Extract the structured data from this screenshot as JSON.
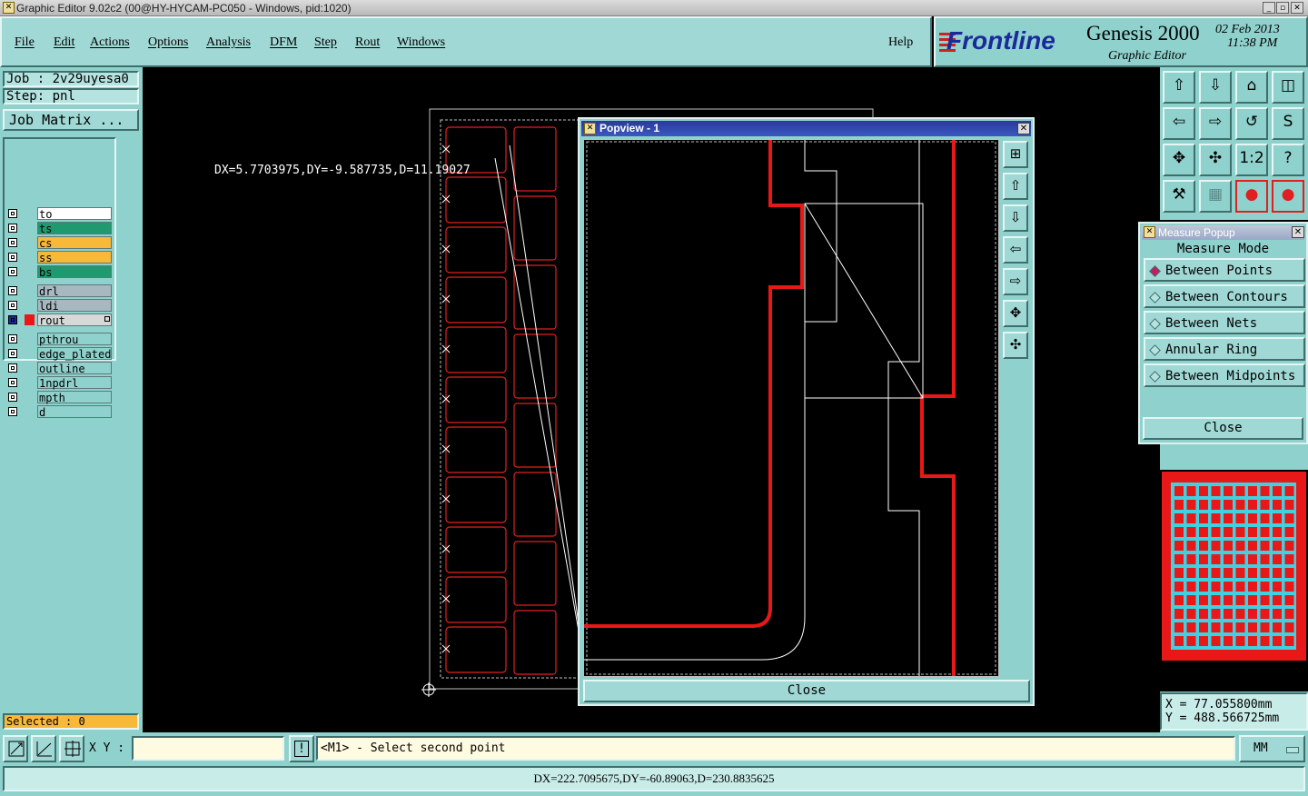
{
  "window": {
    "title": "Graphic Editor 9.02c2 (00@HY-HYCAM-PC050 - Windows, pid:1020)",
    "buttons": [
      "_",
      "▫",
      "✕"
    ]
  },
  "menu": [
    "File",
    "Edit",
    "Actions",
    "Options",
    "Analysis",
    "DFM",
    "Step",
    "Rout",
    "Windows"
  ],
  "help_label": "Help",
  "brand": {
    "logo": "Frontline",
    "product": "Genesis 2000",
    "subtitle": "Graphic Editor",
    "date": "02 Feb 2013",
    "time": "11:38 PM"
  },
  "job": {
    "job_label": "Job : 2v29uyesa0",
    "step_label": "Step: pnl",
    "matrix_button": "Job Matrix ..."
  },
  "layers": [
    {
      "name": "to",
      "color": "#ffffff"
    },
    {
      "name": "ts",
      "color": "#1f9a6e"
    },
    {
      "name": "cs",
      "color": "#f8b838"
    },
    {
      "name": "ss",
      "color": "#f8b838"
    },
    {
      "name": "bs",
      "color": "#1f9a6e"
    },
    {
      "name": "drl",
      "color": "#a8b8c0"
    },
    {
      "name": "ldi",
      "color": "#a8b8c0"
    },
    {
      "name": "rout",
      "color": "#d8d8d8",
      "active": true
    },
    {
      "name": "pthrou",
      "color": "#8fd1cd"
    },
    {
      "name": "edge_plated",
      "color": "#8fd1cd"
    },
    {
      "name": "outline",
      "color": "#8fd1cd"
    },
    {
      "name": "1npdrl",
      "color": "#8fd1cd"
    },
    {
      "name": "mpth",
      "color": "#8fd1cd"
    },
    {
      "name": "d",
      "color": "#8fd1cd"
    }
  ],
  "selected": "Selected : 0",
  "canvas": {
    "measure_text": "DX=5.7703975,DY=-9.587735,D=11.19027"
  },
  "popview": {
    "title": "Popview - 1",
    "close_button": "Close"
  },
  "measure_popup": {
    "title": "Measure Popup",
    "header": "Measure Mode",
    "options": [
      {
        "label": "Between Points",
        "selected": true
      },
      {
        "label": "Between Contours",
        "selected": false
      },
      {
        "label": "Between Nets",
        "selected": false
      },
      {
        "label": "Annular Ring",
        "selected": false
      },
      {
        "label": "Between Midpoints",
        "selected": false
      }
    ],
    "close_button": "Close"
  },
  "coords": {
    "x": "X = 77.055800mm",
    "y": "Y = 488.566725mm"
  },
  "status": {
    "xy_label": "X Y :",
    "xy_value": "",
    "info_glyph": "!",
    "prompt": "<M1> - Select second point",
    "units": "MM",
    "bottom_line": "DX=222.7095675,DY=-60.89063,D=230.8835625"
  }
}
